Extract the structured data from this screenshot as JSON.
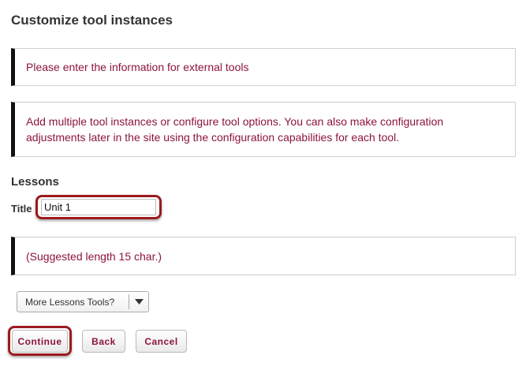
{
  "page": {
    "title": "Customize tool instances"
  },
  "notices": {
    "external_tools": "Please enter the information for external tools",
    "instructions": "Add multiple tool instances or configure tool options. You can also make configuration adjustments later in the site using the configuration capabilities for each tool.",
    "suggested_length": "(Suggested length 15 char.)"
  },
  "lessons": {
    "heading": "Lessons",
    "title_label": "Title",
    "title_value": "Unit 1"
  },
  "dropdown": {
    "label": "More Lessons Tools?",
    "icon": "caret-down-icon"
  },
  "buttons": {
    "continue": "Continue",
    "back": "Back",
    "cancel": "Cancel"
  },
  "colors": {
    "accent_text": "#8c1440",
    "highlight_ring": "#9b1b1f",
    "notice_border": "#111111"
  }
}
